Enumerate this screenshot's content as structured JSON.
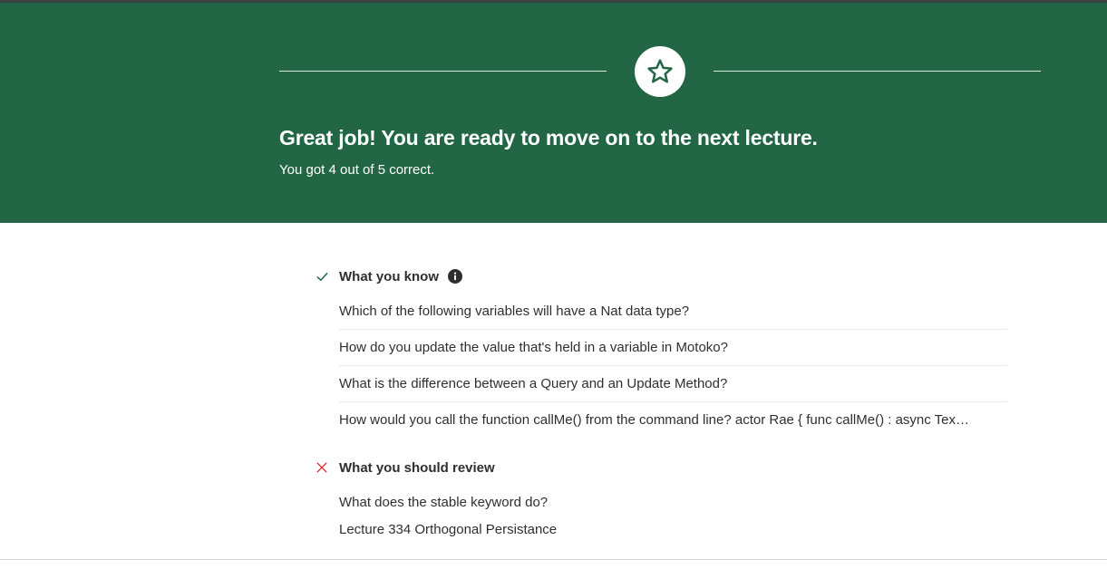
{
  "colors": {
    "banner": "#226646",
    "success": "#1e6055",
    "error": "#d2322d",
    "text": "#2d2f31"
  },
  "banner": {
    "icon": "star-icon",
    "headline": "Great job! You are ready to move on to the next lecture.",
    "score_text": "You got 4 out of 5 correct."
  },
  "know": {
    "title": "What you know",
    "icon": "check-icon",
    "info_icon": "info-icon",
    "items": [
      "Which of the following variables will have a Nat data type?",
      "How do you update the value that's held in a variable in Motoko?",
      "What is the difference between a Query and an Update Method?",
      "How would you call the function callMe() from the command line? actor Rae { func callMe() : async Tex…"
    ]
  },
  "review": {
    "title": "What you should review",
    "icon": "x-icon",
    "question": "What does the stable keyword do?",
    "lecture_link": "Lecture 334 Orthogonal Persistance"
  }
}
